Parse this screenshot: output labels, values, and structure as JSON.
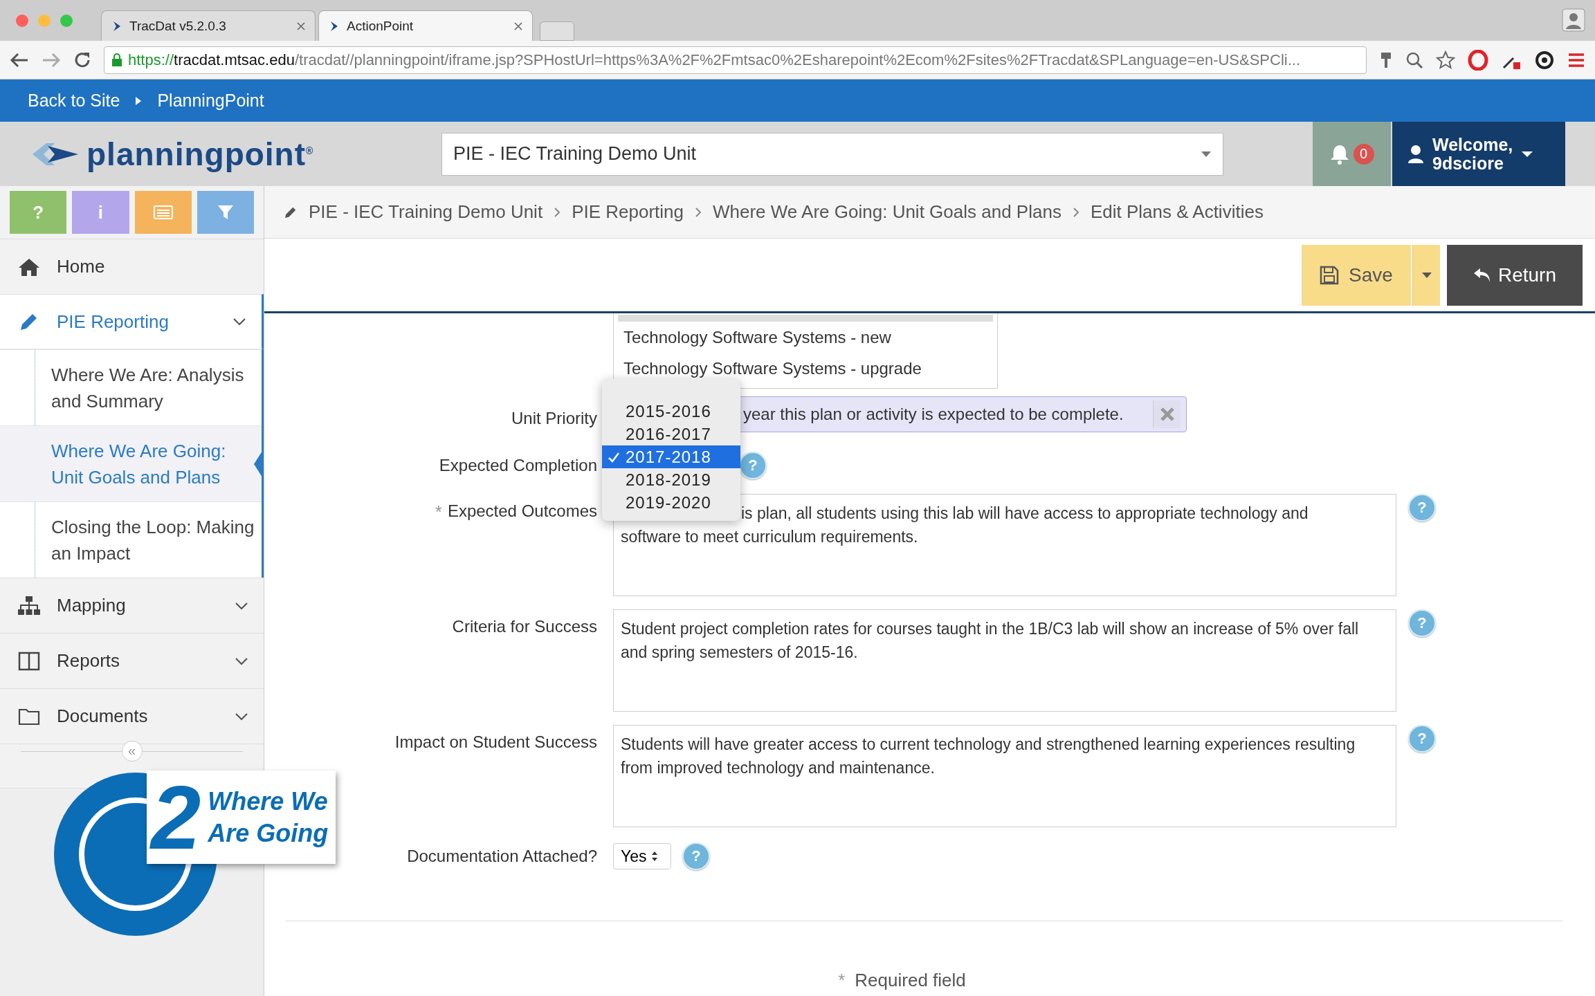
{
  "browser": {
    "tabs": [
      {
        "title": "TracDat v5.2.0.3",
        "selected": false
      },
      {
        "title": "ActionPoint",
        "selected": true
      }
    ],
    "url": {
      "scheme": "https://",
      "host": "tracdat.mtsac.edu",
      "path": "/tracdat//planningpoint/iframe.jsp?SPHostUrl=https%3A%2F%2Fmtsac0%2Esharepoint%2Ecom%2Fsites%2FTracdat&SPLanguage=en-US&SPCli..."
    }
  },
  "topnav": {
    "back": "Back to Site",
    "current": "PlanningPoint"
  },
  "header": {
    "logo": "planningpoint$^{®}$",
    "unit_select": "PIE - IEC Training Demo Unit",
    "notifications": "0",
    "welcome": "Welcome,",
    "user": "9dsciore"
  },
  "sidebar": {
    "tools": [
      {
        "kind": "help",
        "label": "?",
        "color": "#8fc06c"
      },
      {
        "kind": "info",
        "label": "i",
        "color": "#b4a6ea"
      },
      {
        "kind": "list",
        "color": "#f5b35c"
      },
      {
        "kind": "filter",
        "color": "#7cb1e2"
      }
    ],
    "nav": [
      {
        "kind": "home",
        "label": "Home",
        "selected": false
      },
      {
        "kind": "pencil",
        "label": "PIE Reporting",
        "selected": true,
        "expanded": true,
        "children": [
          {
            "label": "Where We Are: Analysis and Summary",
            "selected": false
          },
          {
            "label": "Where We Are Going: Unit Goals and Plans",
            "selected": true
          },
          {
            "label": "Closing the Loop: Making an Impact",
            "selected": false
          }
        ]
      },
      {
        "kind": "sitemap",
        "label": "Mapping",
        "selected": false,
        "expanded": false
      },
      {
        "kind": "columns",
        "label": "Reports",
        "selected": false,
        "expanded": false
      },
      {
        "kind": "folder",
        "label": "Documents",
        "selected": false,
        "expanded": false
      }
    ],
    "collapse": "«",
    "badge": {
      "number": "2",
      "title": "Where We Are Going"
    }
  },
  "breadcrumb": [
    "PIE - IEC Training Demo Unit",
    "PIE Reporting",
    "Where We Are Going: Unit Goals and Plans",
    "Edit Plans & Activities"
  ],
  "actions": {
    "save": "Save",
    "return": "Return"
  },
  "form": {
    "fields": [
      {
        "kind": "listbox",
        "label": "Unit Priority",
        "options": [
          {
            "label": "Technology Software Systems - new",
            "selected": false
          },
          {
            "label": "Technology Software Systems - upgrade",
            "selected": false
          }
        ]
      },
      {
        "kind": "dropdown",
        "label": "Expected Completion",
        "help": "?",
        "tooltip": "year this plan or activity is expected to be complete.",
        "options": [
          {
            "label": "2015-2016",
            "selected": false
          },
          {
            "label": "2016-2017",
            "selected": false
          },
          {
            "label": "2017-2018",
            "selected": true
          },
          {
            "label": "2018-2019",
            "selected": false
          },
          {
            "label": "2019-2020",
            "selected": false
          }
        ]
      },
      {
        "kind": "textarea",
        "label": "Expected Outcomes",
        "required": "*",
        "covered": true,
        "value": "is plan, all students using this lab will have access to appropriate technology and software to meet curriculum requirements.",
        "help": "?"
      },
      {
        "kind": "textarea",
        "label": "Criteria for Success",
        "value": "Student project completion rates for courses taught in the 1B/C3 lab will show an increase of 5% over fall and spring semesters of 2015-16.",
        "help": "?"
      },
      {
        "kind": "textarea",
        "label": "Impact on Student Success",
        "value": "Students will have greater access to current technology and strengthened learning experiences resulting from improved technology and maintenance.",
        "help": "?"
      },
      {
        "kind": "select",
        "label": "Documentation Attached?",
        "value": "Yes",
        "help": "?"
      }
    ],
    "required_note": {
      "mark": "*",
      "text": "Required field"
    }
  }
}
